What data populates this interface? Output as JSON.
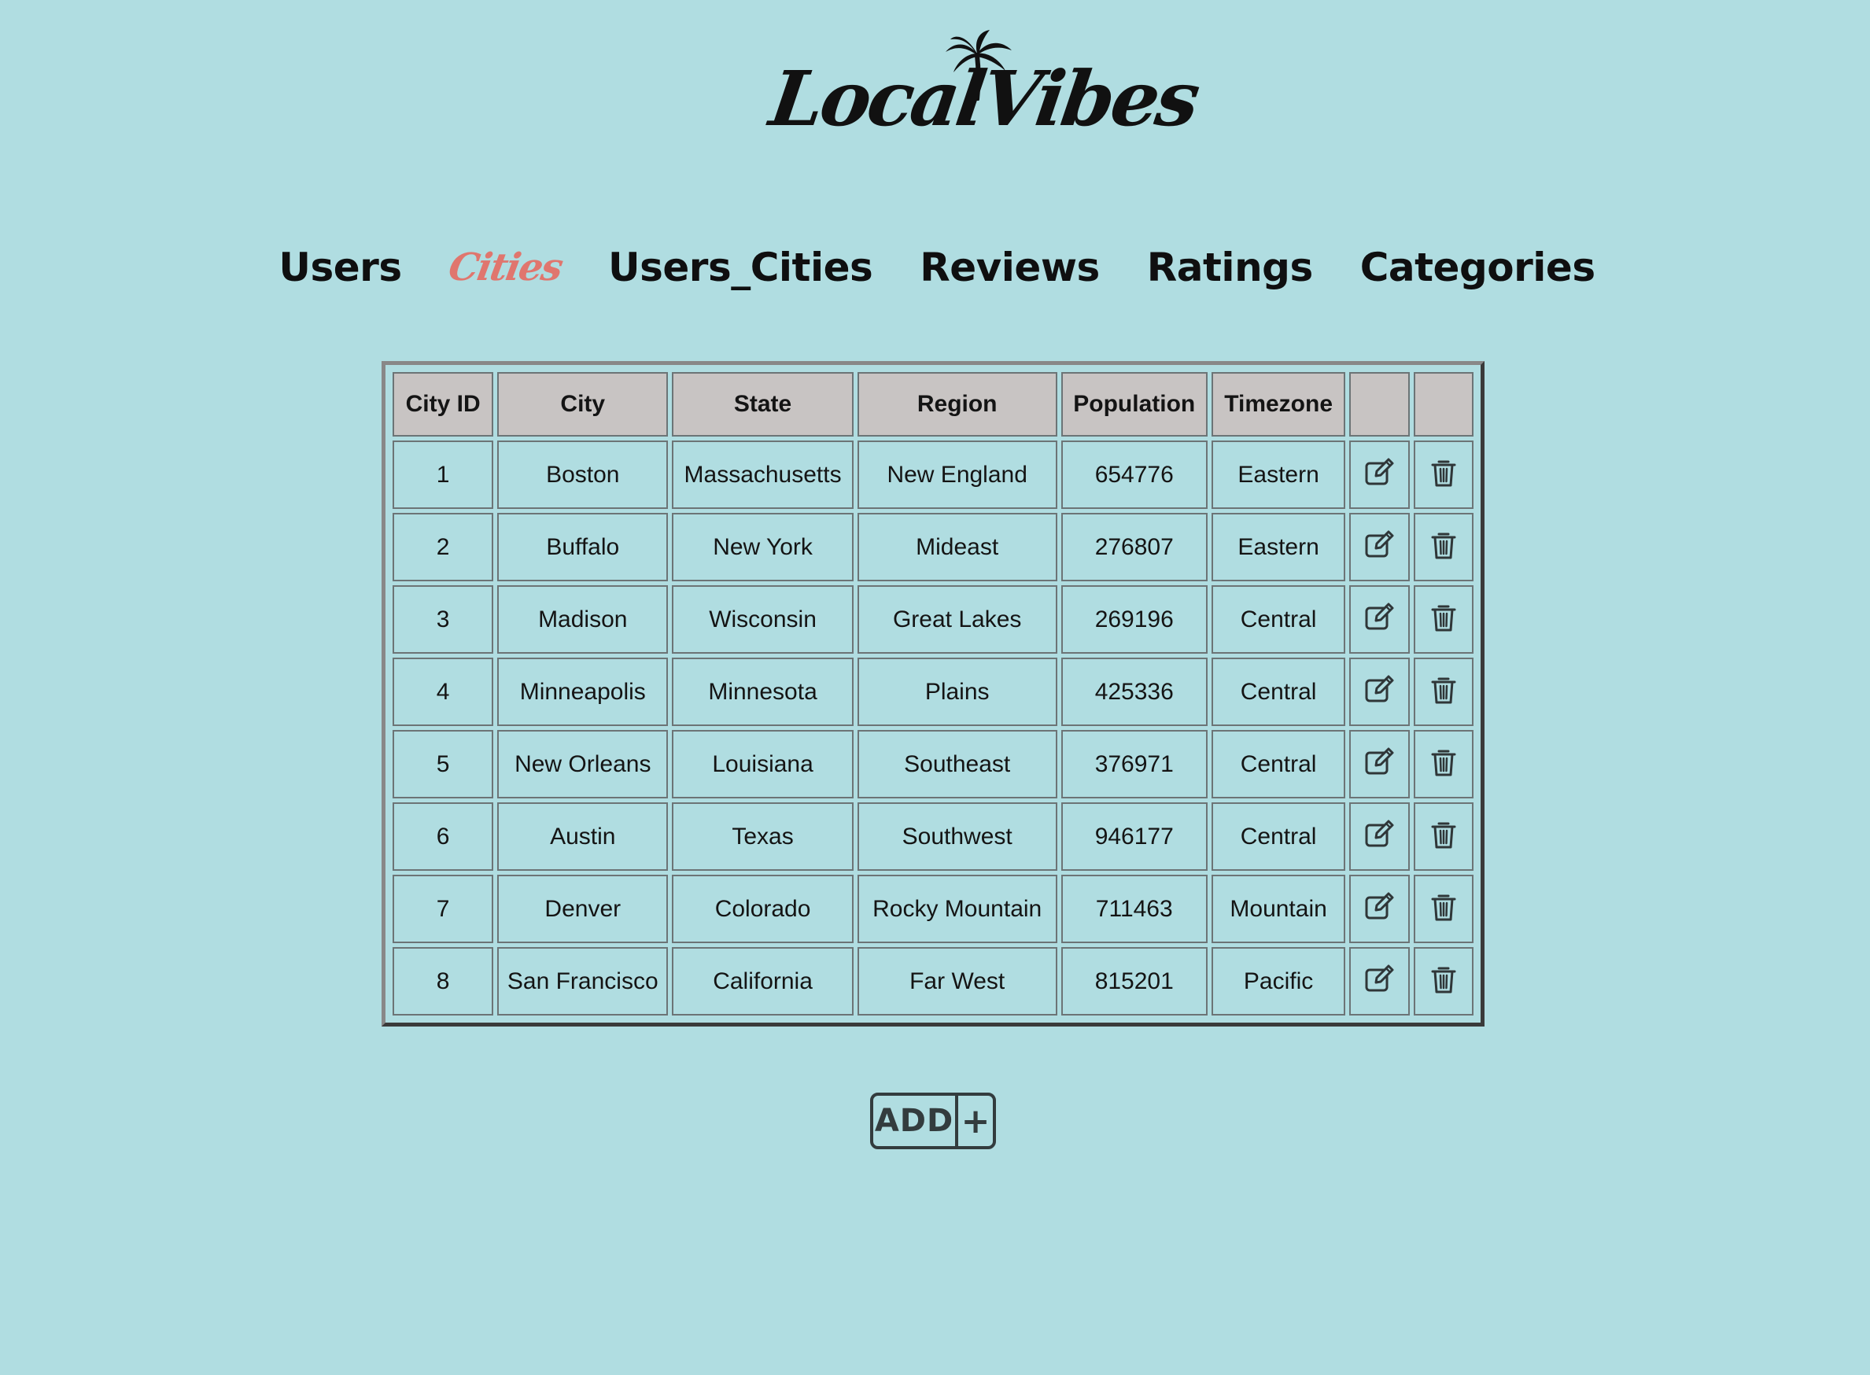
{
  "logo": {
    "text": "LocalVibes",
    "icon": "palm-tree-icon"
  },
  "nav": {
    "items": [
      {
        "label": "Users",
        "active": false
      },
      {
        "label": "Cities",
        "active": true
      },
      {
        "label": "Users_Cities",
        "active": false
      },
      {
        "label": "Reviews",
        "active": false
      },
      {
        "label": "Ratings",
        "active": false
      },
      {
        "label": "Categories",
        "active": false
      }
    ],
    "active_color": "#e0766e"
  },
  "table": {
    "headers": [
      "City ID",
      "City",
      "State",
      "Region",
      "Population",
      "Timezone",
      "",
      ""
    ],
    "rows": [
      {
        "id": "1",
        "city": "Boston",
        "state": "Massachusetts",
        "region": "New England",
        "population": "654776",
        "timezone": "Eastern"
      },
      {
        "id": "2",
        "city": "Buffalo",
        "state": "New York",
        "region": "Mideast",
        "population": "276807",
        "timezone": "Eastern"
      },
      {
        "id": "3",
        "city": "Madison",
        "state": "Wisconsin",
        "region": "Great Lakes",
        "population": "269196",
        "timezone": "Central"
      },
      {
        "id": "4",
        "city": "Minneapolis",
        "state": "Minnesota",
        "region": "Plains",
        "population": "425336",
        "timezone": "Central"
      },
      {
        "id": "5",
        "city": "New Orleans",
        "state": "Louisiana",
        "region": "Southeast",
        "population": "376971",
        "timezone": "Central"
      },
      {
        "id": "6",
        "city": "Austin",
        "state": "Texas",
        "region": "Southwest",
        "population": "946177",
        "timezone": "Central"
      },
      {
        "id": "7",
        "city": "Denver",
        "state": "Colorado",
        "region": "Rocky Mountain",
        "population": "711463",
        "timezone": "Mountain"
      },
      {
        "id": "8",
        "city": "San Francisco",
        "state": "California",
        "region": "Far West",
        "population": "815201",
        "timezone": "Pacific"
      }
    ],
    "edit_icon": "edit-icon",
    "delete_icon": "trash-icon"
  },
  "add_button": {
    "label": "ADD",
    "plus": "+"
  },
  "colors": {
    "background": "#b0dde1",
    "header_bg": "#c8c4c3",
    "active_nav": "#e0766e"
  }
}
